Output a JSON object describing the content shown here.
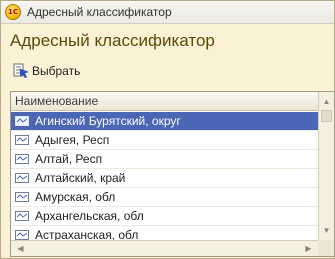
{
  "window": {
    "title": "Адресный классификатор",
    "app_icon_text": "1С"
  },
  "form": {
    "title": "Адресный классификатор"
  },
  "toolbar": {
    "select_label": "Выбрать"
  },
  "grid": {
    "column_header": "Наименование",
    "rows": [
      "Агинский Бурятский, округ",
      "Адыгея, Респ",
      "Алтай, Респ",
      "Алтайский, край",
      "Амурская, обл",
      "Архангельская, обл",
      "Астраханская, обл"
    ],
    "selected_index": 0
  },
  "colors": {
    "accent": "#4a66b4",
    "background": "#fbf2d6",
    "title": "#5a4a0a"
  }
}
